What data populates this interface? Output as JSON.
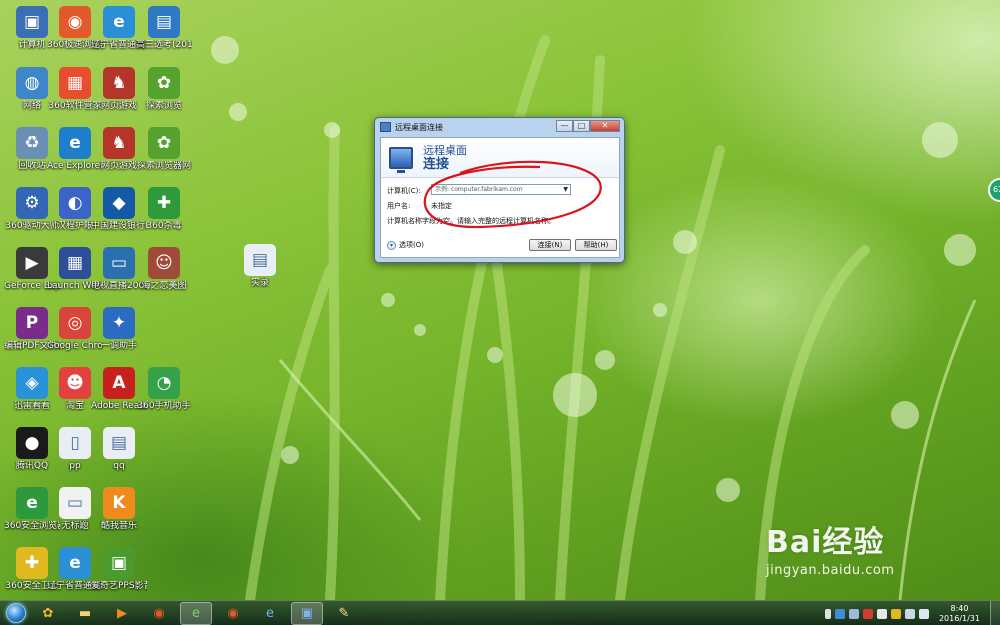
{
  "desktop": {
    "icons": [
      {
        "label": "计算机",
        "name": "computer-icon",
        "color": "#3a6fb5",
        "glyph": "▣",
        "col": 0,
        "row": 0
      },
      {
        "label": "360极速浏览器",
        "name": "browser-360-icon",
        "color": "#e25a2c",
        "glyph": "◉",
        "col": 1,
        "row": 0
      },
      {
        "label": "辽宁省普通高等学校招生...",
        "name": "ie-shortcut-icon",
        "color": "#2b8fd6",
        "glyph": "e",
        "col": 2,
        "row": 0
      },
      {
        "label": "高三选考(2016)计划...",
        "name": "table-doc-icon",
        "color": "#2f78c4",
        "glyph": "▤",
        "col": 3,
        "row": 0
      },
      {
        "label": "网络",
        "name": "network-icon",
        "color": "#3f86c8",
        "glyph": "◍",
        "col": 0,
        "row": 1
      },
      {
        "label": "360软件管家",
        "name": "software-manager-icon",
        "color": "#e84d2e",
        "glyph": "▦",
        "col": 1,
        "row": 1
      },
      {
        "label": "网页游戏",
        "name": "web-game-icon",
        "color": "#b5352a",
        "glyph": "♞",
        "col": 2,
        "row": 1
      },
      {
        "label": "探索浏览",
        "name": "explore-icon",
        "color": "#55a22e",
        "glyph": "✿",
        "col": 3,
        "row": 1
      },
      {
        "label": "回收站",
        "name": "recycle-bin-icon",
        "color": "#6b8fb3",
        "glyph": "♻",
        "col": 0,
        "row": 2
      },
      {
        "label": "Ace Explorer",
        "name": "ace-explorer-icon",
        "color": "#1f7ec9",
        "glyph": "e",
        "col": 1,
        "row": 2
      },
      {
        "label": "网页游戏",
        "name": "web-game-2-icon",
        "color": "#b5352a",
        "glyph": "♞",
        "col": 2,
        "row": 2
      },
      {
        "label": "探索浏览器网",
        "name": "explore-2-icon",
        "color": "#55a22e",
        "glyph": "✿",
        "col": 3,
        "row": 2
      },
      {
        "label": "360驱动大师",
        "name": "driver-master-icon",
        "color": "#3566b5",
        "glyph": "⚙",
        "col": 0,
        "row": 3
      },
      {
        "label": "汉程护眼",
        "name": "eye-care-icon",
        "color": "#3c64c8",
        "glyph": "◐",
        "col": 1,
        "row": 3
      },
      {
        "label": "中国建设银行E路护航安全...",
        "name": "ccb-icon",
        "color": "#1459a8",
        "glyph": "◆",
        "col": 2,
        "row": 3
      },
      {
        "label": "360杀毒",
        "name": "antivirus-icon",
        "color": "#2e9a3b",
        "glyph": "✚",
        "col": 3,
        "row": 3
      },
      {
        "label": "GeForce Experience",
        "name": "geforce-icon",
        "color": "#3a3a3a",
        "glyph": "▶",
        "col": 0,
        "row": 4
      },
      {
        "label": "Launch WordM...",
        "name": "launcher-icon",
        "color": "#2d4f9a",
        "glyph": "▦",
        "col": 1,
        "row": 4
      },
      {
        "label": "电视直播2001 网络电视",
        "name": "tv-icon",
        "color": "#2c6fb0",
        "glyph": "▭",
        "col": 2,
        "row": 4
      },
      {
        "label": "海之恋美图",
        "name": "photo-icon",
        "color": "#a04a3a",
        "glyph": "☺",
        "col": 3,
        "row": 4
      },
      {
        "label": "编辑PDF文件编写",
        "name": "pdf-editor-icon",
        "color": "#7a2c8c",
        "glyph": "P",
        "col": 0,
        "row": 5
      },
      {
        "label": "Google Chrome",
        "name": "chrome-icon",
        "color": "#d9453a",
        "glyph": "◎",
        "col": 1,
        "row": 5
      },
      {
        "label": "一调助手",
        "name": "assistant-icon",
        "color": "#2b6bc2",
        "glyph": "✦",
        "col": 2,
        "row": 5
      },
      {
        "label": "迅雷看看",
        "name": "thunder-icon",
        "color": "#2a92d8",
        "glyph": "◈",
        "col": 0,
        "row": 6
      },
      {
        "label": "淘宝",
        "name": "taobao-icon",
        "color": "#e2413f",
        "glyph": "☻",
        "col": 1,
        "row": 6
      },
      {
        "label": "Adobe Reader XI",
        "name": "adobe-reader-icon",
        "color": "#c8201f",
        "glyph": "A",
        "col": 2,
        "row": 6
      },
      {
        "label": "360手机助手",
        "name": "phone-assistant-icon",
        "color": "#35a24a",
        "glyph": "◔",
        "col": 3,
        "row": 6
      },
      {
        "label": "腾讯QQ",
        "name": "qq-icon",
        "color": "#1a1a1a",
        "glyph": "●",
        "col": 0,
        "row": 7
      },
      {
        "label": "pp",
        "name": "file-pp-icon",
        "color": "#e9eef4",
        "glyph": "▯",
        "col": 1,
        "row": 7
      },
      {
        "label": "qq",
        "name": "file-qq-icon",
        "color": "#e9eef4",
        "glyph": "▤",
        "col": 2,
        "row": 7
      },
      {
        "label": "360安全浏览器7",
        "name": "browser-360-safe-icon",
        "color": "#2c9a3c",
        "glyph": "e",
        "col": 0,
        "row": 8
      },
      {
        "label": "无标题",
        "name": "untitled-icon",
        "color": "#f1f1f1",
        "glyph": "▭",
        "col": 1,
        "row": 8
      },
      {
        "label": "酷我音乐",
        "name": "kuwo-icon",
        "color": "#f08a1c",
        "glyph": "K",
        "col": 2,
        "row": 8
      },
      {
        "label": "360安全卫士",
        "name": "security-guard-icon",
        "color": "#e0b81f",
        "glyph": "✚",
        "col": 0,
        "row": 9
      },
      {
        "label": "辽宁省普通高等学校招生...",
        "name": "ie-shortcut-2-icon",
        "color": "#2b8fd6",
        "glyph": "e",
        "col": 1,
        "row": 9
      },
      {
        "label": "爱奇艺PPS影音",
        "name": "iqiyi-icon",
        "color": "#4a9a2e",
        "glyph": "▣",
        "col": 2,
        "row": 9
      },
      {
        "label": "实录",
        "name": "doc-shilu-icon",
        "color": "#e9eef4",
        "glyph": "▤",
        "col": 4,
        "row": 4
      }
    ]
  },
  "dialog": {
    "window_title": "远程桌面连接",
    "banner_line1": "远程桌面",
    "banner_line2": "连接",
    "computer_label": "计算机(C):",
    "computer_placeholder": "示例: computer.fabrikam.com",
    "user_label": "用户名:",
    "user_value": "未指定",
    "hint": "计算机名称字段为空。请输入完整的远程计算机名称。",
    "options_label": "选项(O)",
    "connect_label": "连接(N)",
    "help_label": "帮助(H)",
    "minimize": "—",
    "maximize": "□",
    "close": "✕"
  },
  "taskbar": {
    "clock_time": "8:40",
    "clock_date": "2016/1/31"
  },
  "watermark": {
    "brand": "Bai经验",
    "url": "jingyan.baidu.com"
  },
  "side_badge": "62"
}
